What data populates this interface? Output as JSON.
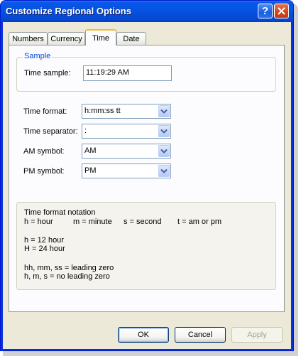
{
  "window": {
    "title": "Customize Regional Options"
  },
  "title_buttons": {
    "help": "?",
    "close": "X"
  },
  "tabs": [
    {
      "label": "Numbers",
      "active": false
    },
    {
      "label": "Currency",
      "active": false
    },
    {
      "label": "Time",
      "active": true
    },
    {
      "label": "Date",
      "active": false
    }
  ],
  "sample": {
    "group_label": "Sample",
    "time_label": "Time sample:",
    "time_value": "11:19:29 AM"
  },
  "fields": {
    "time_format": {
      "label": "Time format:",
      "value": "h:mm:ss tt"
    },
    "time_separator": {
      "label": "Time separator:",
      "value": ":"
    },
    "am_symbol": {
      "label": "AM symbol:",
      "value": "AM"
    },
    "pm_symbol": {
      "label": "PM symbol:",
      "value": "PM"
    }
  },
  "notation": {
    "heading": "Time format notation",
    "line_hour": "h = hour",
    "line_minute": "m = minute",
    "line_second": "s = second",
    "line_ampm": "t = am or pm",
    "h12": "h = 12 hour",
    "h24": "H = 24 hour",
    "leading_zero": "hh, mm, ss = leading zero",
    "no_leading_zero": "h, m, s = no leading zero"
  },
  "buttons": {
    "ok": "OK",
    "cancel": "Cancel",
    "apply": "Apply"
  },
  "colors": {
    "title_bar": "#0553e3",
    "dialog_bg": "#ece9d8",
    "accent_legend": "#0046d5"
  }
}
